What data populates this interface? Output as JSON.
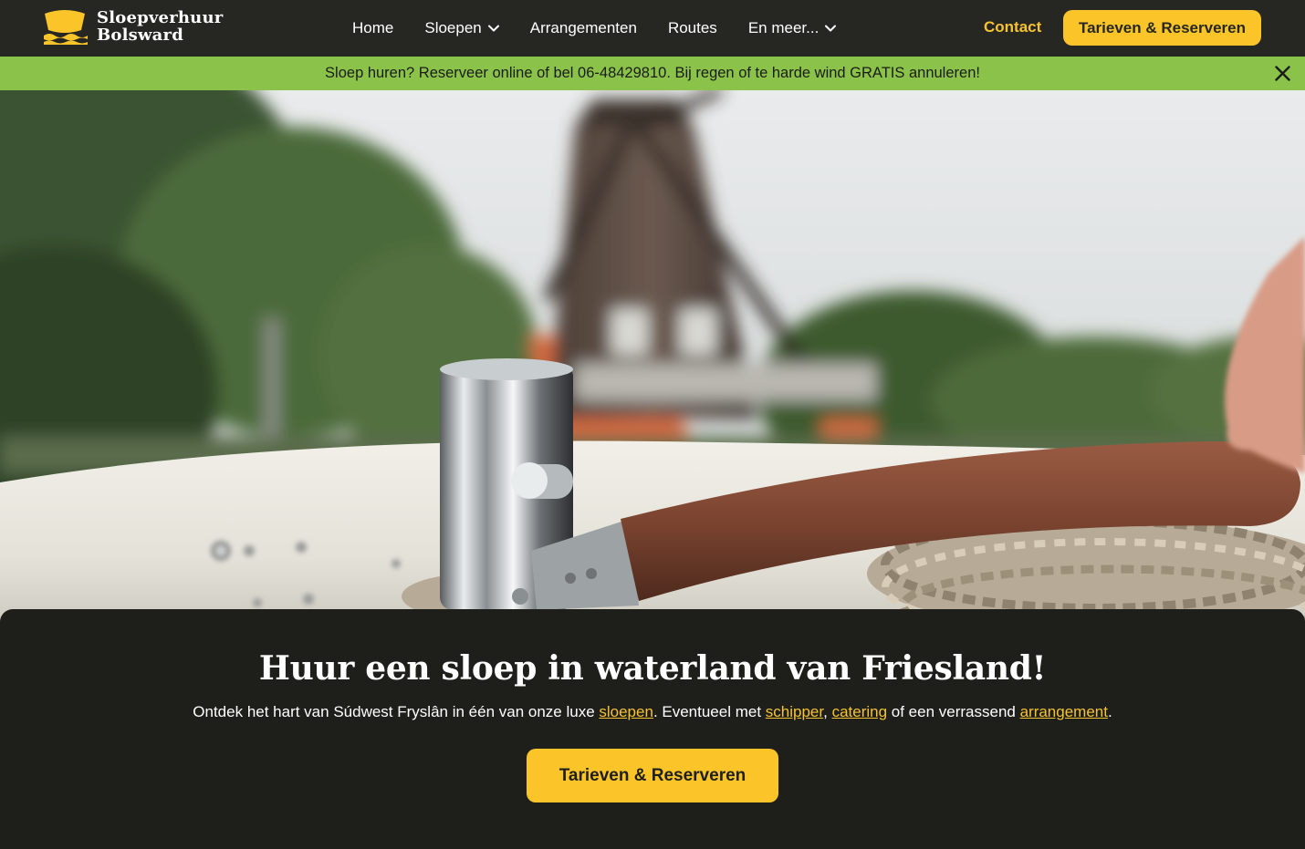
{
  "brand": {
    "name_line1": "Sloepverhuur",
    "name_line2": "Bolsward",
    "logo_icon": "boat-wave-icon",
    "accent_color": "#fbc52a",
    "dark_color": "#262722",
    "banner_color": "#8bc34a"
  },
  "nav": {
    "items": [
      {
        "label": "Home",
        "dropdown": false
      },
      {
        "label": "Sloepen",
        "dropdown": true
      },
      {
        "label": "Arrangementen",
        "dropdown": false
      },
      {
        "label": "Routes",
        "dropdown": false
      },
      {
        "label": "En meer...",
        "dropdown": true
      }
    ],
    "contact_label": "Contact",
    "cta_label": "Tarieven & Reserveren"
  },
  "announcement": {
    "text": "Sloep huren? Reserveer online of bel 06-48429810. Bij regen of te harde wind GRATIS annuleren!",
    "close_icon": "close-icon"
  },
  "hero": {
    "image_subject": "windmill-boat-bollard-photo"
  },
  "main": {
    "title": "Huur een sloep in waterland van Friesland!",
    "text_part1": "Ontdek het hart van Súdwest Fryslân in één van onze luxe ",
    "link_sloepen": "sloepen",
    "text_part2": ". Eventueel met ",
    "link_schipper": "schipper",
    "text_sep": ", ",
    "link_catering": "catering",
    "text_part3": " of een verrassend ",
    "link_arrangement": "arrangement",
    "text_end": ".",
    "cta_label": "Tarieven & Reserveren"
  }
}
